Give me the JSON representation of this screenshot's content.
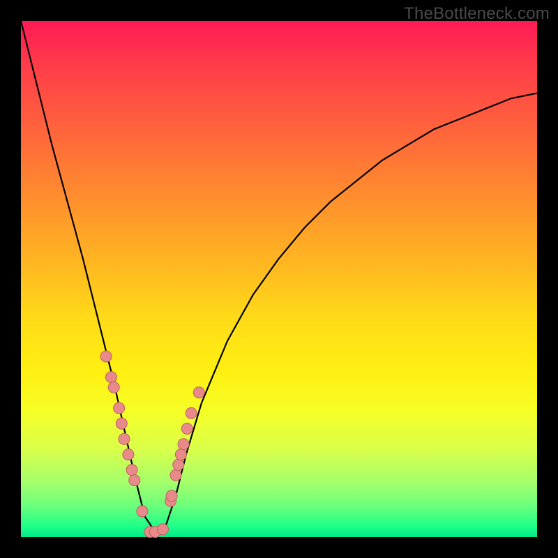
{
  "watermark": "TheBottleneck.com",
  "colors": {
    "frame": "#000000",
    "curve_stroke": "#000000",
    "dot_fill": "#e88a8a",
    "dot_stroke": "#bf5f5f",
    "gradient_top": "#ff1a55",
    "gradient_bottom": "#00e88a"
  },
  "chart_data": {
    "type": "line",
    "title": "",
    "xlabel": "",
    "ylabel": "",
    "x_range": [
      0,
      100
    ],
    "y_range": [
      0,
      100
    ],
    "note": "x is normalized horizontal position (percent of plot width), y is bottleneck percent (0 at bottom/green, 100 at top/red). Curve minimum (zero bottleneck) near x≈24–27. Dots mark measured points along the curve. Values estimated from pixel positions.",
    "series": [
      {
        "name": "bottleneck-curve",
        "x": [
          0,
          3,
          6,
          9,
          12,
          14,
          16,
          18,
          20,
          22,
          24,
          26,
          28,
          30,
          32,
          35,
          40,
          45,
          50,
          55,
          60,
          65,
          70,
          75,
          80,
          85,
          90,
          95,
          100
        ],
        "y": [
          100,
          88,
          76,
          65,
          54,
          46,
          38,
          30,
          21,
          12,
          4,
          1,
          2,
          8,
          16,
          26,
          38,
          47,
          54,
          60,
          65,
          69,
          73,
          76,
          79,
          81,
          83,
          85,
          86
        ]
      },
      {
        "name": "measured-dots",
        "x": [
          16.5,
          17.5,
          18.0,
          19.0,
          19.5,
          20.0,
          20.8,
          21.5,
          22.0,
          23.5,
          25.0,
          26.0,
          27.5,
          29.0,
          29.2,
          30.0,
          30.5,
          31.0,
          31.5,
          32.2,
          33.0,
          34.5
        ],
        "y": [
          35,
          31,
          29,
          25,
          22,
          19,
          16,
          13,
          11,
          5,
          1,
          1,
          1.5,
          7,
          8,
          12,
          14,
          16,
          18,
          21,
          24,
          28
        ]
      }
    ]
  }
}
